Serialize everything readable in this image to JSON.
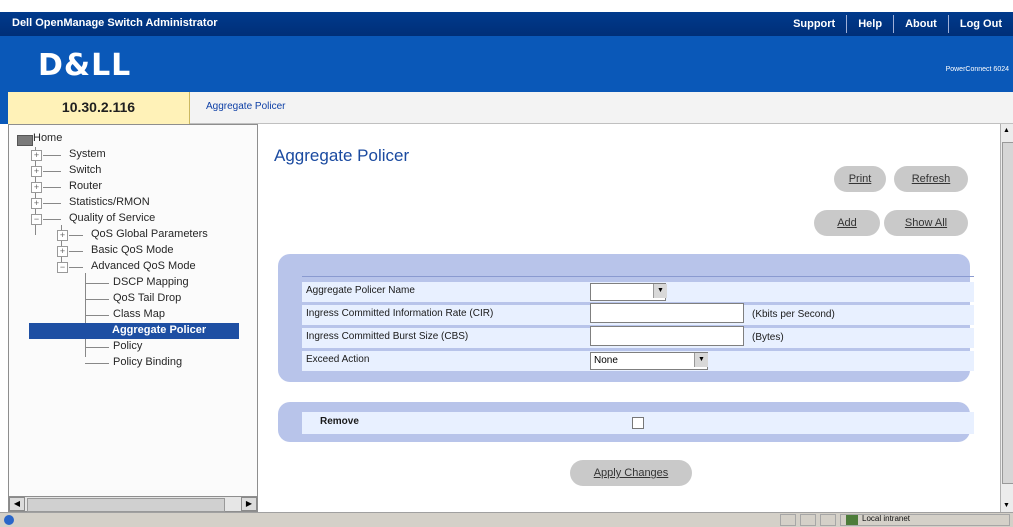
{
  "app": {
    "title": "Dell OpenManage Switch Administrator"
  },
  "top_links": [
    "Support",
    "Help",
    "About",
    "Log Out"
  ],
  "banner": {
    "logo": "D&LL",
    "model": "PowerConnect 6024"
  },
  "device": {
    "ip": "10.30.2.116"
  },
  "breadcrumb": "Aggregate Policer",
  "nav": {
    "home": "Home",
    "items": [
      "System",
      "Switch",
      "Router",
      "Statistics/RMON",
      "Quality of Service"
    ],
    "qos": [
      "QoS Global Parameters",
      "Basic QoS Mode",
      "Advanced QoS Mode"
    ],
    "advanced": [
      "DSCP Mapping",
      "QoS Tail Drop",
      "Class Map",
      "Aggregate Policer",
      "Policy",
      "Policy Binding"
    ]
  },
  "page": {
    "title": "Aggregate Policer",
    "buttons": {
      "print": "Print",
      "refresh": "Refresh",
      "add": "Add",
      "show_all": "Show All",
      "apply": "Apply Changes"
    }
  },
  "form": {
    "name_label": "Aggregate Policer Name",
    "name_value": "",
    "cir_label": "Ingress Committed Information Rate (CIR)",
    "cir_value": "",
    "cir_unit": "(Kbits per Second)",
    "cbs_label": "Ingress Committed Burst Size (CBS)",
    "cbs_value": "",
    "cbs_unit": "(Bytes)",
    "exceed_label": "Exceed Action",
    "exceed_value": "None",
    "remove_label": "Remove",
    "remove_checked": false
  },
  "status": {
    "zone": "Local intranet"
  }
}
